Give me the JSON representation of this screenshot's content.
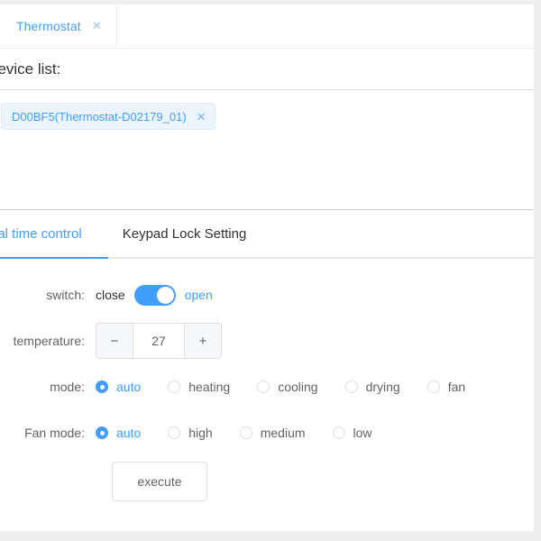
{
  "window": {
    "document_tab": {
      "label": "Thermostat",
      "close_icon": "close-icon"
    }
  },
  "device_section": {
    "label": "device list:",
    "tags": [
      {
        "label": "D00BF5(Thermostat-D02179_01)",
        "close_icon": "close-icon"
      }
    ]
  },
  "inner_tabs": {
    "items": [
      {
        "label": "real time control",
        "active": true
      },
      {
        "label": "Keypad Lock Setting",
        "active": false
      }
    ]
  },
  "form": {
    "switch": {
      "label": "switch:",
      "off_text": "close",
      "on_text": "open",
      "state": "on"
    },
    "temperature": {
      "label": "temperature:",
      "decrease_icon": "minus-icon",
      "increase_icon": "plus-icon",
      "value": "27"
    },
    "mode": {
      "label": "mode:",
      "options": [
        {
          "label": "auto",
          "selected": true
        },
        {
          "label": "heating",
          "selected": false
        },
        {
          "label": "cooling",
          "selected": false
        },
        {
          "label": "drying",
          "selected": false
        },
        {
          "label": "fan",
          "selected": false
        }
      ]
    },
    "fan_mode": {
      "label": "Fan mode:",
      "options": [
        {
          "label": "auto",
          "selected": true
        },
        {
          "label": "high",
          "selected": false
        },
        {
          "label": "medium",
          "selected": false
        },
        {
          "label": "low",
          "selected": false
        }
      ]
    },
    "submit": {
      "label": "execute"
    }
  },
  "colors": {
    "accent": "#409eff",
    "tag_bg": "#ecf5ff",
    "border": "#dcdfe6",
    "text": "#606266"
  }
}
